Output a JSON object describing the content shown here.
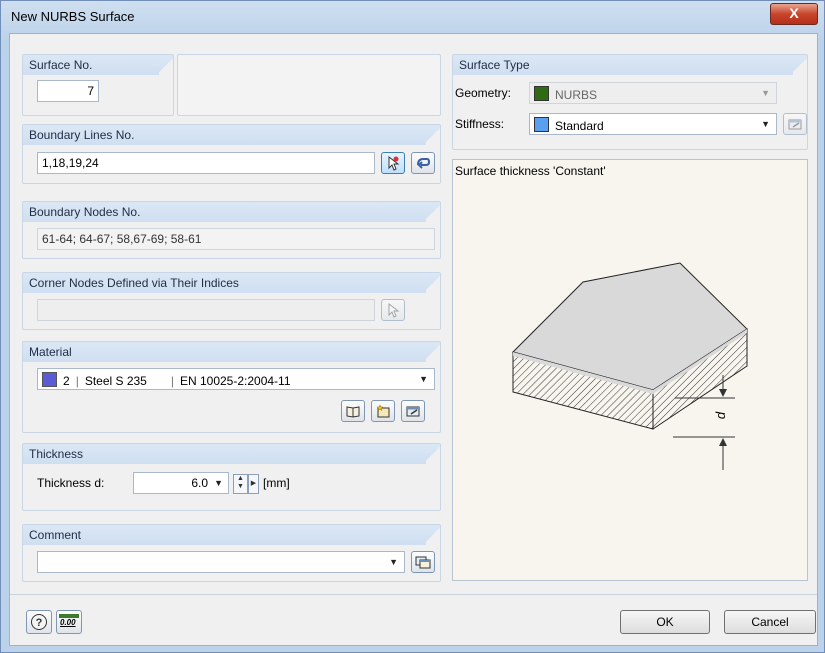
{
  "window": {
    "title": "New NURBS Surface",
    "close_glyph": "X"
  },
  "surface_no": {
    "label": "Surface No.",
    "value": "7"
  },
  "boundary_lines": {
    "label": "Boundary Lines No.",
    "value": "1,18,19,24"
  },
  "boundary_nodes": {
    "label": "Boundary Nodes No.",
    "value": "61-64; 64-67; 58,67-69; 58-61"
  },
  "corner_nodes": {
    "label": "Corner Nodes Defined via Their Indices",
    "value": ""
  },
  "material": {
    "label": "Material",
    "number": "2",
    "name": "Steel S 235",
    "standard": "EN 10025-2:2004-11",
    "color": "#5b5bd6"
  },
  "thickness": {
    "label": "Thickness",
    "field_label": "Thickness d:",
    "value": "6.0",
    "unit": "[mm]"
  },
  "comment": {
    "label": "Comment",
    "value": ""
  },
  "surface_type": {
    "label": "Surface Type",
    "geometry_label": "Geometry:",
    "geometry_value": "NURBS",
    "geometry_color": "#2e6b12",
    "stiffness_label": "Stiffness:",
    "stiffness_value": "Standard",
    "stiffness_color": "#5aa0f0"
  },
  "preview": {
    "caption": "Surface thickness 'Constant'",
    "dim_label": "d"
  },
  "buttons": {
    "ok": "OK",
    "cancel": "Cancel",
    "units_label": "0.00"
  }
}
